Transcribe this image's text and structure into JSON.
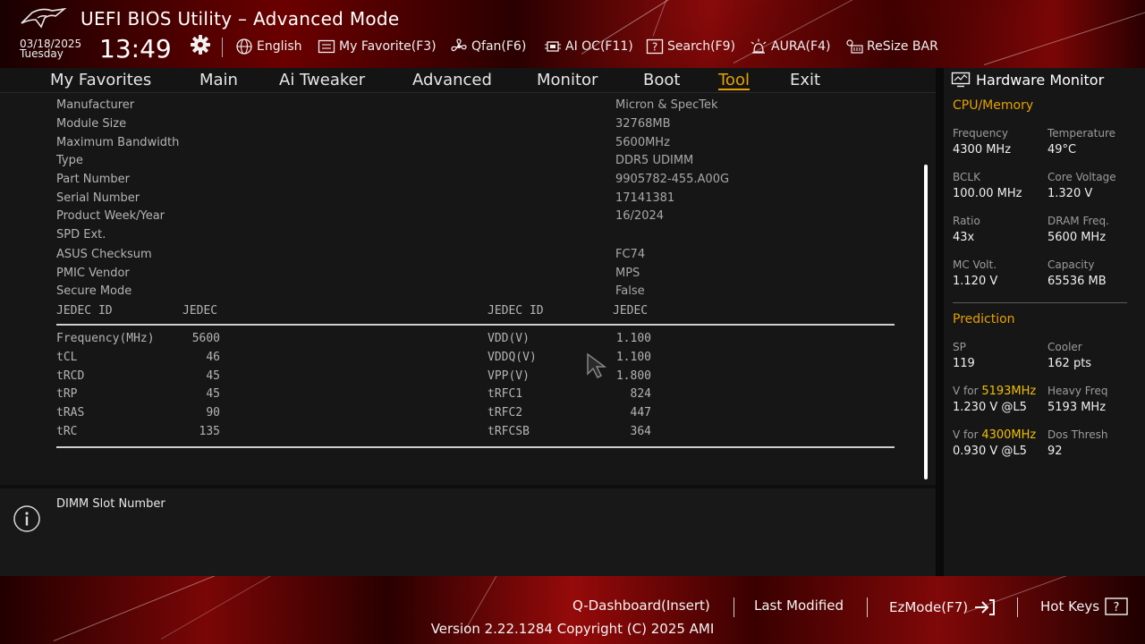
{
  "header": {
    "title": "UEFI BIOS Utility – Advanced Mode",
    "date": "03/18/2025",
    "weekday": "Tuesday",
    "time": "13:49",
    "tools": [
      {
        "label": "English",
        "icon": "globe-icon"
      },
      {
        "label": "My Favorite(F3)",
        "icon": "favorite-list-icon"
      },
      {
        "label": "Qfan(F6)",
        "icon": "fan-icon"
      },
      {
        "label": "AI OC(F11)",
        "icon": "chip-icon"
      },
      {
        "label": "Search(F9)",
        "icon": "search-help-icon"
      },
      {
        "label": "AURA(F4)",
        "icon": "aura-light-icon"
      },
      {
        "label": "ReSize BAR",
        "icon": "resize-bar-icon"
      }
    ]
  },
  "nav": {
    "tabs": [
      "My Favorites",
      "Main",
      "Ai Tweaker",
      "Advanced",
      "Monitor",
      "Boot",
      "Tool",
      "Exit"
    ],
    "active": "Tool"
  },
  "spd": {
    "info": [
      {
        "label": "Manufacturer",
        "value": "Micron & SpecTek"
      },
      {
        "label": "Module Size",
        "value": "32768MB"
      },
      {
        "label": "Maximum Bandwidth",
        "value": "5600MHz"
      },
      {
        "label": "Type",
        "value": "DDR5 UDIMM"
      },
      {
        "label": "Part Number",
        "value": "9905782-455.A00G"
      },
      {
        "label": "Serial Number",
        "value": "17141381"
      },
      {
        "label": "Product Week/Year",
        "value": "16/2024"
      },
      {
        "label": "SPD Ext.",
        "value": ""
      },
      {
        "label": "ASUS Checksum",
        "value": "FC74"
      },
      {
        "label": "PMIC Vendor",
        "value": "MPS"
      },
      {
        "label": "Secure Mode",
        "value": "False"
      }
    ],
    "jedec_header": {
      "left_id": "JEDEC ID",
      "left_val": "JEDEC",
      "right_id": "JEDEC ID",
      "right_val": "JEDEC"
    },
    "timings_left": [
      {
        "label": "Frequency(MHz)",
        "value": "5600"
      },
      {
        "label": "tCL",
        "value": "46"
      },
      {
        "label": "tRCD",
        "value": "45"
      },
      {
        "label": "tRP",
        "value": "45"
      },
      {
        "label": "tRAS",
        "value": "90"
      },
      {
        "label": "tRC",
        "value": "135"
      }
    ],
    "timings_right": [
      {
        "label": "VDD(V)",
        "value": "1.100"
      },
      {
        "label": "VDDQ(V)",
        "value": "1.100"
      },
      {
        "label": "VPP(V)",
        "value": "1.800"
      },
      {
        "label": "tRFC1",
        "value": "824"
      },
      {
        "label": "tRFC2",
        "value": "447"
      },
      {
        "label": "tRFCSB",
        "value": "364"
      }
    ]
  },
  "help": {
    "text": "DIMM Slot Number"
  },
  "hwmon": {
    "title": "Hardware Monitor",
    "cpu_section": "CPU/Memory",
    "cpu": [
      {
        "key": "Frequency",
        "value": "4300 MHz"
      },
      {
        "key": "Temperature",
        "value": "49°C"
      },
      {
        "key": "BCLK",
        "value": "100.00 MHz"
      },
      {
        "key": "Core Voltage",
        "value": "1.320 V"
      },
      {
        "key": "Ratio",
        "value": "43x"
      },
      {
        "key": "DRAM Freq.",
        "value": "5600 MHz"
      },
      {
        "key": "MC Volt.",
        "value": "1.120 V"
      },
      {
        "key": "Capacity",
        "value": "65536 MB"
      }
    ],
    "pred_section": "Prediction",
    "pred": {
      "sp_key": "SP",
      "sp_val": "119",
      "cooler_key": "Cooler",
      "cooler_val": "162 pts",
      "v1_prefix": "V for ",
      "v1_freq": "5193MHz",
      "v1_val": "1.230 V @L5",
      "heavy_key": "Heavy Freq",
      "heavy_val": "5193 MHz",
      "v2_prefix": "V for ",
      "v2_freq": "4300MHz",
      "v2_val": "0.930 V @L5",
      "dos_key": "Dos Thresh",
      "dos_val": "92"
    }
  },
  "footer": {
    "qdash": "Q-Dashboard(Insert)",
    "last_modified": "Last Modified",
    "ezmode": "EzMode(F7)",
    "hotkeys": "Hot Keys",
    "version": "Version 2.22.1284 Copyright (C) 2025 AMI"
  },
  "colors": {
    "accent": "#e6a100",
    "highlight": "#f0c000",
    "brand_red": "#8a0a0a"
  }
}
